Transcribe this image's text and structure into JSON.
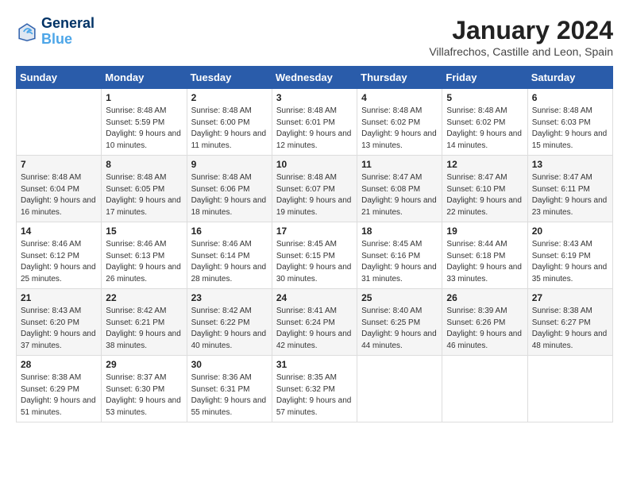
{
  "logo": {
    "line1": "General",
    "line2": "Blue"
  },
  "title": "January 2024",
  "location": "Villafrechos, Castille and Leon, Spain",
  "days_of_week": [
    "Sunday",
    "Monday",
    "Tuesday",
    "Wednesday",
    "Thursday",
    "Friday",
    "Saturday"
  ],
  "weeks": [
    [
      {
        "day": "",
        "sunrise": "",
        "sunset": "",
        "daylight": ""
      },
      {
        "day": "1",
        "sunrise": "Sunrise: 8:48 AM",
        "sunset": "Sunset: 5:59 PM",
        "daylight": "Daylight: 9 hours and 10 minutes."
      },
      {
        "day": "2",
        "sunrise": "Sunrise: 8:48 AM",
        "sunset": "Sunset: 6:00 PM",
        "daylight": "Daylight: 9 hours and 11 minutes."
      },
      {
        "day": "3",
        "sunrise": "Sunrise: 8:48 AM",
        "sunset": "Sunset: 6:01 PM",
        "daylight": "Daylight: 9 hours and 12 minutes."
      },
      {
        "day": "4",
        "sunrise": "Sunrise: 8:48 AM",
        "sunset": "Sunset: 6:02 PM",
        "daylight": "Daylight: 9 hours and 13 minutes."
      },
      {
        "day": "5",
        "sunrise": "Sunrise: 8:48 AM",
        "sunset": "Sunset: 6:02 PM",
        "daylight": "Daylight: 9 hours and 14 minutes."
      },
      {
        "day": "6",
        "sunrise": "Sunrise: 8:48 AM",
        "sunset": "Sunset: 6:03 PM",
        "daylight": "Daylight: 9 hours and 15 minutes."
      }
    ],
    [
      {
        "day": "7",
        "sunrise": "Sunrise: 8:48 AM",
        "sunset": "Sunset: 6:04 PM",
        "daylight": "Daylight: 9 hours and 16 minutes."
      },
      {
        "day": "8",
        "sunrise": "Sunrise: 8:48 AM",
        "sunset": "Sunset: 6:05 PM",
        "daylight": "Daylight: 9 hours and 17 minutes."
      },
      {
        "day": "9",
        "sunrise": "Sunrise: 8:48 AM",
        "sunset": "Sunset: 6:06 PM",
        "daylight": "Daylight: 9 hours and 18 minutes."
      },
      {
        "day": "10",
        "sunrise": "Sunrise: 8:48 AM",
        "sunset": "Sunset: 6:07 PM",
        "daylight": "Daylight: 9 hours and 19 minutes."
      },
      {
        "day": "11",
        "sunrise": "Sunrise: 8:47 AM",
        "sunset": "Sunset: 6:08 PM",
        "daylight": "Daylight: 9 hours and 21 minutes."
      },
      {
        "day": "12",
        "sunrise": "Sunrise: 8:47 AM",
        "sunset": "Sunset: 6:10 PM",
        "daylight": "Daylight: 9 hours and 22 minutes."
      },
      {
        "day": "13",
        "sunrise": "Sunrise: 8:47 AM",
        "sunset": "Sunset: 6:11 PM",
        "daylight": "Daylight: 9 hours and 23 minutes."
      }
    ],
    [
      {
        "day": "14",
        "sunrise": "Sunrise: 8:46 AM",
        "sunset": "Sunset: 6:12 PM",
        "daylight": "Daylight: 9 hours and 25 minutes."
      },
      {
        "day": "15",
        "sunrise": "Sunrise: 8:46 AM",
        "sunset": "Sunset: 6:13 PM",
        "daylight": "Daylight: 9 hours and 26 minutes."
      },
      {
        "day": "16",
        "sunrise": "Sunrise: 8:46 AM",
        "sunset": "Sunset: 6:14 PM",
        "daylight": "Daylight: 9 hours and 28 minutes."
      },
      {
        "day": "17",
        "sunrise": "Sunrise: 8:45 AM",
        "sunset": "Sunset: 6:15 PM",
        "daylight": "Daylight: 9 hours and 30 minutes."
      },
      {
        "day": "18",
        "sunrise": "Sunrise: 8:45 AM",
        "sunset": "Sunset: 6:16 PM",
        "daylight": "Daylight: 9 hours and 31 minutes."
      },
      {
        "day": "19",
        "sunrise": "Sunrise: 8:44 AM",
        "sunset": "Sunset: 6:18 PM",
        "daylight": "Daylight: 9 hours and 33 minutes."
      },
      {
        "day": "20",
        "sunrise": "Sunrise: 8:43 AM",
        "sunset": "Sunset: 6:19 PM",
        "daylight": "Daylight: 9 hours and 35 minutes."
      }
    ],
    [
      {
        "day": "21",
        "sunrise": "Sunrise: 8:43 AM",
        "sunset": "Sunset: 6:20 PM",
        "daylight": "Daylight: 9 hours and 37 minutes."
      },
      {
        "day": "22",
        "sunrise": "Sunrise: 8:42 AM",
        "sunset": "Sunset: 6:21 PM",
        "daylight": "Daylight: 9 hours and 38 minutes."
      },
      {
        "day": "23",
        "sunrise": "Sunrise: 8:42 AM",
        "sunset": "Sunset: 6:22 PM",
        "daylight": "Daylight: 9 hours and 40 minutes."
      },
      {
        "day": "24",
        "sunrise": "Sunrise: 8:41 AM",
        "sunset": "Sunset: 6:24 PM",
        "daylight": "Daylight: 9 hours and 42 minutes."
      },
      {
        "day": "25",
        "sunrise": "Sunrise: 8:40 AM",
        "sunset": "Sunset: 6:25 PM",
        "daylight": "Daylight: 9 hours and 44 minutes."
      },
      {
        "day": "26",
        "sunrise": "Sunrise: 8:39 AM",
        "sunset": "Sunset: 6:26 PM",
        "daylight": "Daylight: 9 hours and 46 minutes."
      },
      {
        "day": "27",
        "sunrise": "Sunrise: 8:38 AM",
        "sunset": "Sunset: 6:27 PM",
        "daylight": "Daylight: 9 hours and 48 minutes."
      }
    ],
    [
      {
        "day": "28",
        "sunrise": "Sunrise: 8:38 AM",
        "sunset": "Sunset: 6:29 PM",
        "daylight": "Daylight: 9 hours and 51 minutes."
      },
      {
        "day": "29",
        "sunrise": "Sunrise: 8:37 AM",
        "sunset": "Sunset: 6:30 PM",
        "daylight": "Daylight: 9 hours and 53 minutes."
      },
      {
        "day": "30",
        "sunrise": "Sunrise: 8:36 AM",
        "sunset": "Sunset: 6:31 PM",
        "daylight": "Daylight: 9 hours and 55 minutes."
      },
      {
        "day": "31",
        "sunrise": "Sunrise: 8:35 AM",
        "sunset": "Sunset: 6:32 PM",
        "daylight": "Daylight: 9 hours and 57 minutes."
      },
      {
        "day": "",
        "sunrise": "",
        "sunset": "",
        "daylight": ""
      },
      {
        "day": "",
        "sunrise": "",
        "sunset": "",
        "daylight": ""
      },
      {
        "day": "",
        "sunrise": "",
        "sunset": "",
        "daylight": ""
      }
    ]
  ]
}
